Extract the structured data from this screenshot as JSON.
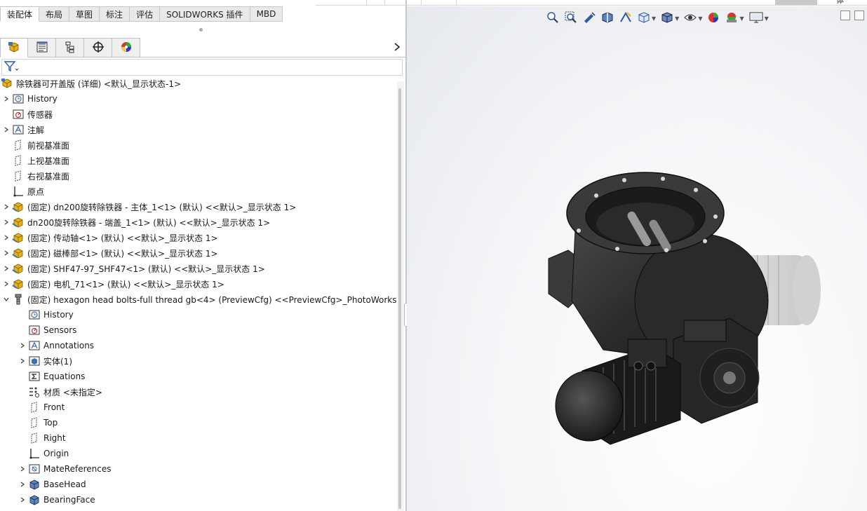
{
  "top_tabs": [
    {
      "label": "装配体",
      "active": true
    },
    {
      "label": "布局"
    },
    {
      "label": "草图"
    },
    {
      "label": "标注"
    },
    {
      "label": "评估"
    },
    {
      "label": "SOLIDWORKS 插件"
    },
    {
      "label": "MBD"
    }
  ],
  "top_strip_label": "体",
  "manager_tabs": [
    {
      "name": "featuremanager-icon"
    },
    {
      "name": "propertymanager-icon"
    },
    {
      "name": "configurationmanager-icon"
    },
    {
      "name": "dimxpertmanager-icon"
    },
    {
      "name": "displaymanager-icon"
    }
  ],
  "tree": {
    "root": "除铁器可开盖版 (详细) <默认_显示状态-1>",
    "items": [
      {
        "label": "History",
        "expander": "▸",
        "icon": "history-folder-icon"
      },
      {
        "label": "传感器",
        "expander": "",
        "icon": "sensors-folder-icon"
      },
      {
        "label": "注解",
        "expander": "▸",
        "icon": "annotations-folder-icon"
      },
      {
        "label": "前视基准面",
        "expander": "",
        "icon": "plane-icon"
      },
      {
        "label": "上视基准面",
        "expander": "",
        "icon": "plane-icon"
      },
      {
        "label": "右视基准面",
        "expander": "",
        "icon": "plane-icon"
      },
      {
        "label": "原点",
        "expander": "",
        "icon": "origin-icon"
      },
      {
        "label": "(固定) dn200旋转除铁器 - 主体_1<1> (默认) <<默认>_显示状态 1>",
        "expander": "▸",
        "icon": "subassembly-icon"
      },
      {
        "label": "dn200旋转除铁器 - 端盖_1<1> (默认) <<默认>_显示状态 1>",
        "expander": "▸",
        "icon": "subassembly-icon"
      },
      {
        "label": "(固定) 传动轴<1> (默认) <<默认>_显示状态 1>",
        "expander": "▸",
        "icon": "subassembly-icon"
      },
      {
        "label": "(固定) 磁棒部<1> (默认) <<默认>_显示状态 1>",
        "expander": "▸",
        "icon": "subassembly-icon"
      },
      {
        "label": "(固定) SHF47-97_SHF47<1> (默认) <<默认>_显示状态 1>",
        "expander": "▸",
        "icon": "subassembly-icon"
      },
      {
        "label": "(固定) 电机_71<1> (默认) <<默认>_显示状态 1>",
        "expander": "▸",
        "icon": "subassembly-icon"
      },
      {
        "label": "(固定) hexagon head bolts-full thread gb<4> (PreviewCfg) <<PreviewCfg>_PhotoWorks",
        "expander": "▾",
        "icon": "bolt-part-icon"
      }
    ],
    "children": [
      {
        "label": "History",
        "expander": "",
        "icon": "history-folder-icon"
      },
      {
        "label": "Sensors",
        "expander": "",
        "icon": "sensors-folder-icon"
      },
      {
        "label": "Annotations",
        "expander": "▸",
        "icon": "annotations-folder-icon"
      },
      {
        "label": "实体(1)",
        "expander": "▸",
        "icon": "solid-bodies-folder-icon"
      },
      {
        "label": "Equations",
        "expander": "",
        "icon": "equations-folder-icon"
      },
      {
        "label": "材质 <未指定>",
        "expander": "",
        "icon": "material-icon"
      },
      {
        "label": "Front",
        "expander": "",
        "icon": "plane-icon"
      },
      {
        "label": "Top",
        "expander": "",
        "icon": "plane-icon"
      },
      {
        "label": "Right",
        "expander": "",
        "icon": "plane-icon"
      },
      {
        "label": "Origin",
        "expander": "",
        "icon": "origin-icon"
      },
      {
        "label": "MateReferences",
        "expander": "▸",
        "icon": "matereferences-folder-icon"
      },
      {
        "label": "BaseHead",
        "expander": "▸",
        "icon": "feature-icon"
      },
      {
        "label": "BearingFace",
        "expander": "▸",
        "icon": "feature-icon"
      }
    ]
  },
  "hud_tools": [
    {
      "name": "zoom-to-fit-icon",
      "caret": false
    },
    {
      "name": "zoom-to-area-icon",
      "caret": false
    },
    {
      "name": "previous-view-icon",
      "caret": false
    },
    {
      "name": "section-view-icon",
      "caret": false
    },
    {
      "name": "dynamic-annotation-icon",
      "caret": false
    },
    {
      "name": "view-orientation-icon",
      "caret": true
    },
    {
      "name": "display-style-icon",
      "caret": true
    },
    {
      "name": "hide-show-items-icon",
      "caret": true
    },
    {
      "name": "edit-appearance-icon",
      "caret": false
    },
    {
      "name": "apply-scene-icon",
      "caret": true
    },
    {
      "name": "view-settings-icon",
      "caret": true
    }
  ],
  "colors": {
    "tab_active": "#ffffff",
    "tab_inactive": "#e9e9e9",
    "viewport_bg": "#e6e9ee",
    "model_dark": "#2b2b2b",
    "model_ghost": "#c9c9c9",
    "assembly_yellow": "#e8b21a",
    "folder_blue": "#3f6fb5"
  }
}
